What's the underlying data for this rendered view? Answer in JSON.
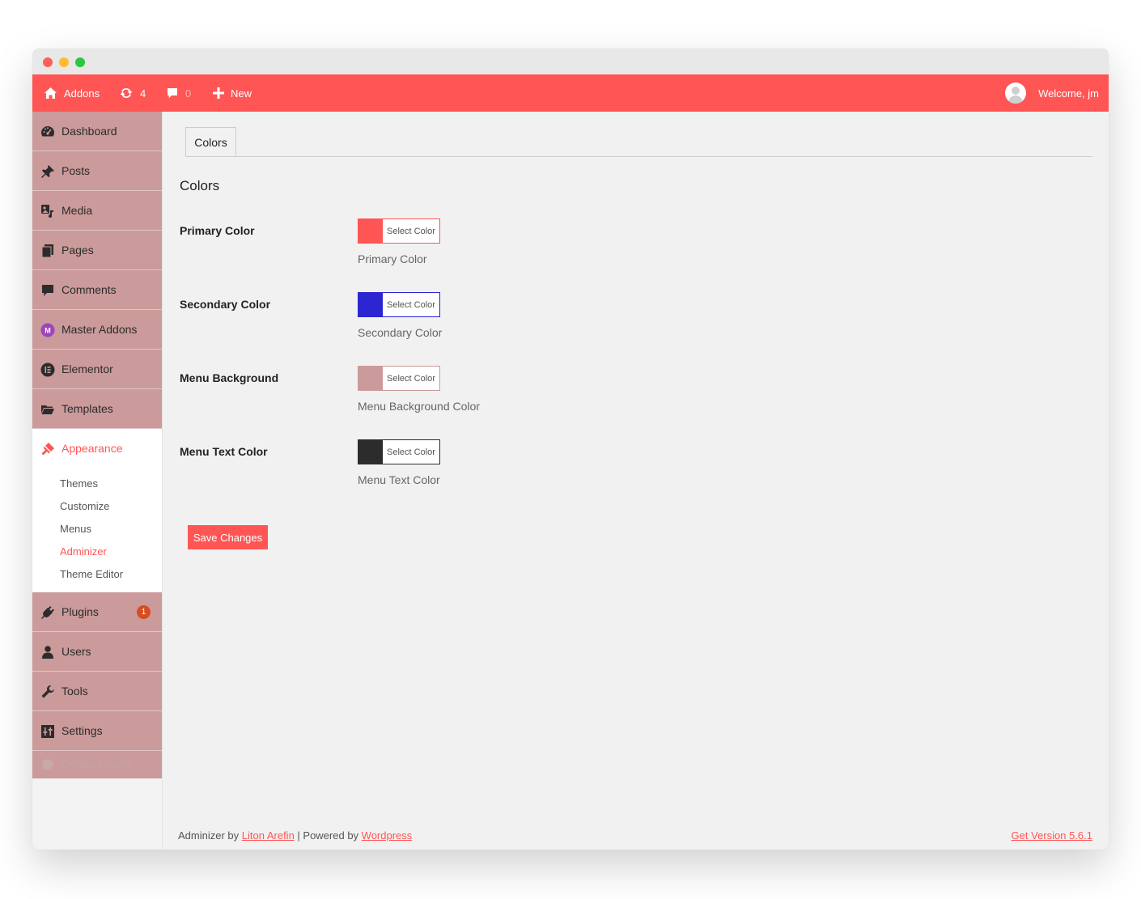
{
  "adminbar": {
    "site_name": "Addons",
    "updates_count": "4",
    "comments_count": "0",
    "new_label": "New",
    "welcome": "Welcome, jm"
  },
  "sidebar": {
    "items": [
      {
        "label": "Dashboard",
        "icon": "dashboard-icon"
      },
      {
        "label": "Posts",
        "icon": "pin-icon"
      },
      {
        "label": "Media",
        "icon": "media-icon"
      },
      {
        "label": "Pages",
        "icon": "pages-icon"
      },
      {
        "label": "Comments",
        "icon": "comment-icon"
      },
      {
        "label": "Master Addons",
        "icon": "master-addons-icon"
      },
      {
        "label": "Elementor",
        "icon": "elementor-icon"
      },
      {
        "label": "Templates",
        "icon": "folder-icon"
      },
      {
        "label": "Appearance",
        "icon": "brush-icon"
      }
    ],
    "submenu": [
      "Themes",
      "Customize",
      "Menus",
      "Adminizer",
      "Theme Editor"
    ],
    "items_after": [
      {
        "label": "Plugins",
        "icon": "plug-icon",
        "badge": "1"
      },
      {
        "label": "Users",
        "icon": "user-icon"
      },
      {
        "label": "Tools",
        "icon": "wrench-icon"
      },
      {
        "label": "Settings",
        "icon": "settings-icon"
      }
    ],
    "collapse_label": "Collapse menu"
  },
  "main": {
    "tab": "Colors",
    "section_title": "Colors",
    "button_label": "Select Color",
    "fields": [
      {
        "label": "Primary Color",
        "desc": "Primary Color",
        "color": "#ff5555"
      },
      {
        "label": "Secondary Color",
        "desc": "Secondary Color",
        "color": "#2b25d2"
      },
      {
        "label": "Menu Background",
        "desc": "Menu Background Color",
        "color": "#cb9a9a"
      },
      {
        "label": "Menu Text Color",
        "desc": "Menu Text Color",
        "color": "#2c2c2c"
      }
    ],
    "save_label": "Save Changes"
  },
  "footer": {
    "prefix": "Adminizer by ",
    "author": "Liton Arefin",
    "middle": " | Powered by ",
    "powered": "Wordpress",
    "version": "Get Version 5.6.1"
  },
  "colors": {
    "accent": "#ff5555",
    "menu_bg": "#cb9a9a",
    "badge": "#d54e21"
  }
}
